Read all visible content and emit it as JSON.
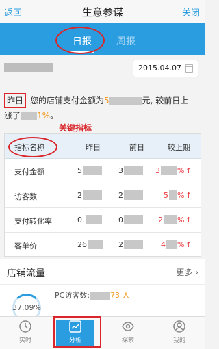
{
  "nav": {
    "back": "返回",
    "title": "生意参谋",
    "close": "关闭"
  },
  "tabs": {
    "daily": "日报",
    "weekly": "周报"
  },
  "date": {
    "value": "2015.04.07"
  },
  "summary": {
    "yesterday": "昨日",
    "text_a": "您的店铺支付金额为",
    "amount_prefix": "5",
    "text_b": "元, 较前日上",
    "text_c": "涨了",
    "pct_suffix": "1%",
    "text_d": "。"
  },
  "key_metrics": "关键指标",
  "table": {
    "headers": [
      "指标名称",
      "昨日",
      "前日",
      "较上期"
    ],
    "rows": [
      {
        "name": "支付金额",
        "y": "5",
        "d": "3",
        "r": "3",
        "pct": "%"
      },
      {
        "name": "访客数",
        "y": "2",
        "d": "2",
        "r": "5",
        "pct": "%"
      },
      {
        "name": "支付转化率",
        "y": "0.",
        "d": "0",
        "r": "2",
        "pct": "%"
      },
      {
        "name": "客单价",
        "y": "26",
        "d": "2",
        "r": "4",
        "pct": "%"
      }
    ]
  },
  "traffic": {
    "title": "店铺流量",
    "more": "更多",
    "ring_label": "37.09%",
    "pc_prefix": "PC访客数:",
    "pc_suffix": "73 人"
  },
  "bottom_nav": [
    {
      "label": "实时",
      "icon": "clock-icon"
    },
    {
      "label": "分析",
      "icon": "trend-chart-icon"
    },
    {
      "label": "探索",
      "icon": "eye-icon"
    },
    {
      "label": "我的",
      "icon": "person-icon"
    }
  ],
  "colors": {
    "brand": "#2a9de0",
    "accent": "#f39a1e",
    "alert": "#e8393e",
    "annotation": "#d9262b"
  }
}
